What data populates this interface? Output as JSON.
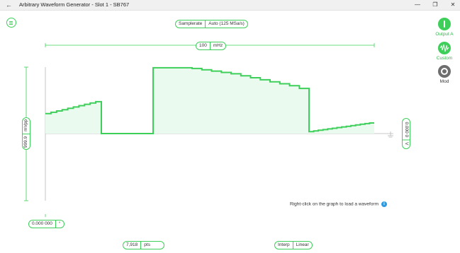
{
  "window": {
    "title": "Arbitrary Waveform Generator - Slot 1 - SB767",
    "back_icon": "←",
    "min_icon": "—",
    "max_icon": "❐",
    "close_icon": "✕"
  },
  "samplerate": {
    "label": "Samplerate",
    "value": "Auto (125 MSa/s)"
  },
  "frequency": {
    "value": "100",
    "unit": "mHz"
  },
  "amplitude": {
    "value": "999.9",
    "unit": "mVpp"
  },
  "offset": {
    "value": "0.000 0",
    "unit": "V"
  },
  "phase": {
    "value": "0.000 000",
    "unit": "°"
  },
  "points": {
    "value": "7,918",
    "unit": "pts"
  },
  "interp": {
    "label": "Interp",
    "value": "Linear"
  },
  "hint": "Right-click on the graph to load a waveform",
  "sidebar": {
    "output_label": "Output A",
    "custom_label": "Custom",
    "mod_label": "Mod"
  },
  "colors": {
    "accent": "#3ecf5a",
    "fill": "#eafaee",
    "axis": "#b8b8b8"
  },
  "waveform": {
    "sample_count": 7918,
    "levels": [
      0.3,
      0.32,
      0.34,
      0.36,
      0.38,
      0.4,
      0.42,
      0.44,
      0.46,
      0.48,
      0.0,
      0.0,
      0.0,
      0.0,
      0.0,
      0.99,
      0.99,
      0.99,
      0.99,
      0.98,
      0.96,
      0.94,
      0.92,
      0.9,
      0.87,
      0.84,
      0.81,
      0.78,
      0.75,
      0.72,
      0.68,
      0.03,
      0.04,
      0.05,
      0.06,
      0.07,
      0.08,
      0.09,
      0.1,
      0.11,
      0.12,
      0.13,
      0.14,
      0.15,
      0.16
    ],
    "segments": [
      {
        "type": "ramp",
        "from": 0.0,
        "to": 0.175,
        "levels_start": 0,
        "levels_count": 10
      },
      {
        "type": "flat",
        "from": 0.175,
        "to": 0.335
      },
      {
        "type": "ramp",
        "from": 0.335,
        "to": 0.78
      },
      {
        "type": "ramp",
        "from": 0.78,
        "to": 1.0
      }
    ]
  }
}
